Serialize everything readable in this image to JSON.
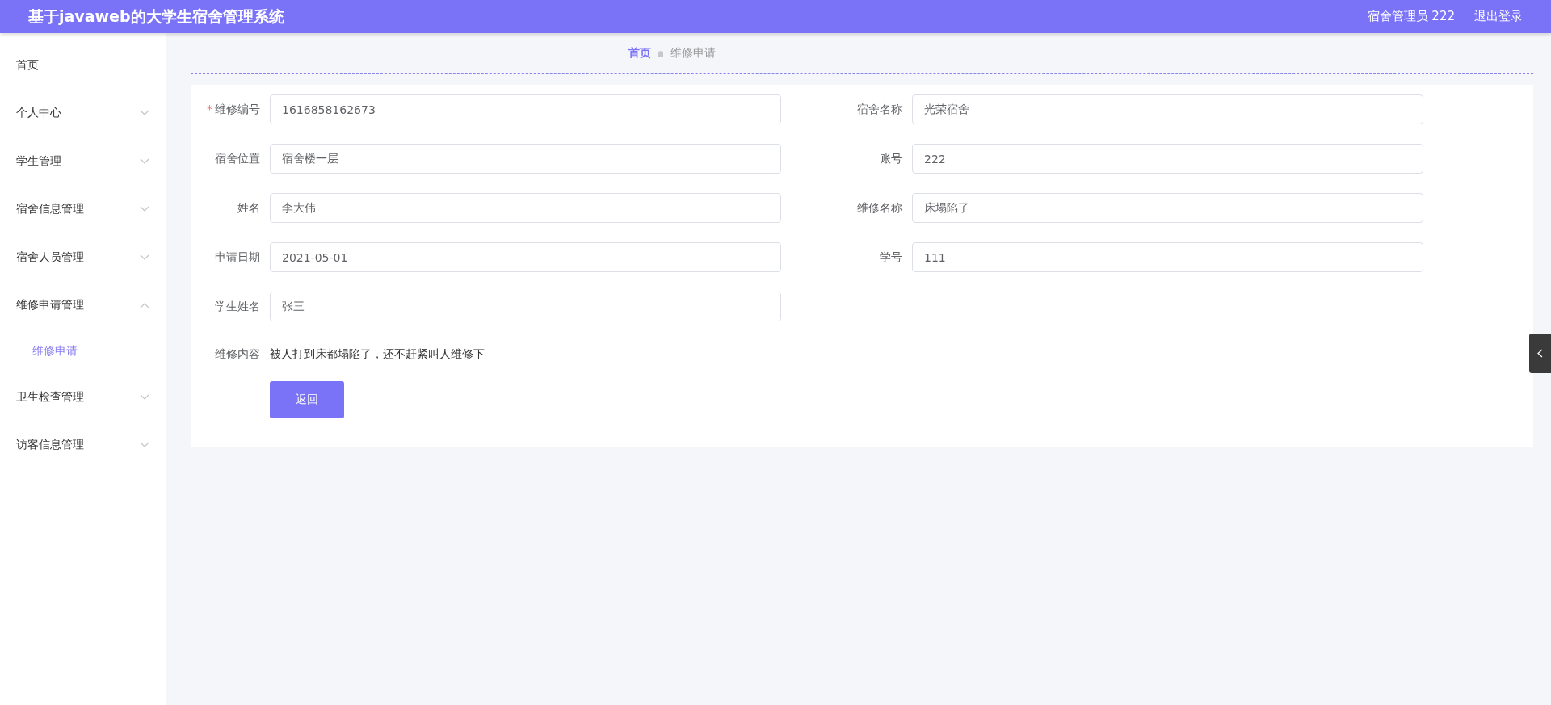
{
  "header": {
    "title": "基于javaweb的大学生宿舍管理系统",
    "user": "宿舍管理员 222",
    "logout": "退出登录"
  },
  "sidebar": {
    "items": [
      {
        "label": "首页",
        "selected": false
      },
      {
        "label": "个人中心",
        "selected": false,
        "expanded": false
      },
      {
        "label": "学生管理",
        "selected": false,
        "expanded": false
      },
      {
        "label": "宿舍信息管理",
        "selected": false,
        "expanded": false
      },
      {
        "label": "宿舍人员管理",
        "selected": false,
        "expanded": false
      },
      {
        "label": "维修申请管理",
        "selected": false,
        "expanded": true,
        "children": [
          {
            "label": "维修申请",
            "selected": true
          }
        ]
      },
      {
        "label": "卫生检查管理",
        "selected": false,
        "expanded": false
      },
      {
        "label": "访客信息管理",
        "selected": false,
        "expanded": false
      }
    ]
  },
  "breadcrumb": [
    {
      "label": "首页",
      "selected": true
    },
    {
      "label": "维修申请",
      "selected": false
    }
  ],
  "form": {
    "rows": [
      [
        {
          "label": "维修编号",
          "value": "1616858162673",
          "marker": "*"
        },
        {
          "label": "宿舍名称",
          "value": "光荣宿舍"
        }
      ],
      [
        {
          "label": "宿舍位置",
          "value": "宿舍楼一层"
        },
        {
          "label": "账号",
          "value": "222"
        }
      ],
      [
        {
          "label": "姓名",
          "value": "李大伟"
        },
        {
          "label": "维修名称",
          "value": "床塌陷了"
        }
      ],
      [
        {
          "label": "申请日期",
          "value": "2021-05-01"
        },
        {
          "label": "学号",
          "value": "111"
        }
      ],
      [
        {
          "label": "学生姓名",
          "value": "张三"
        }
      ]
    ],
    "content": {
      "label": "维修内容",
      "text": "被人打到床都塌陷了，还不赶紧叫人维修下"
    },
    "button": "返回"
  }
}
